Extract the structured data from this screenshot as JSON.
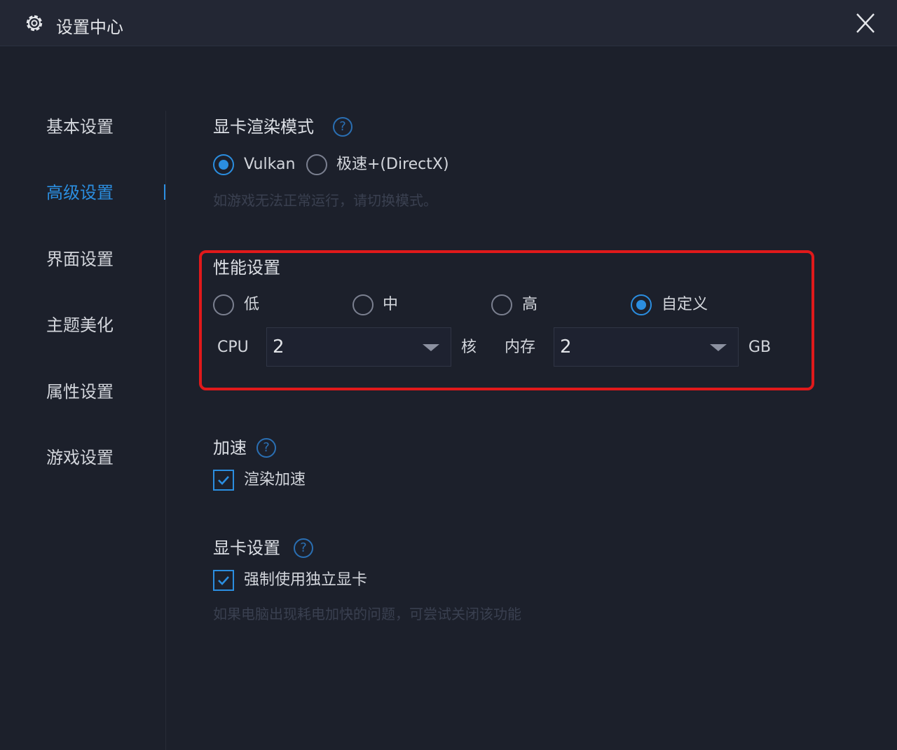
{
  "window": {
    "title": "设置中心",
    "title_icon": "gear-icon",
    "close_icon": "close-icon"
  },
  "sidebar": {
    "items": [
      {
        "label": "基本设置",
        "active": false
      },
      {
        "label": "高级设置",
        "active": true
      },
      {
        "label": "界面设置",
        "active": false
      },
      {
        "label": "主题美化",
        "active": false
      },
      {
        "label": "属性设置",
        "active": false
      },
      {
        "label": "游戏设置",
        "active": false
      }
    ]
  },
  "render_mode": {
    "title": "显卡渲染模式",
    "help": "?",
    "options": [
      {
        "label": "Vulkan",
        "checked": true
      },
      {
        "label": "极速+(DirectX)",
        "checked": false
      }
    ],
    "hint": "如游戏无法正常运行，请切换模式。"
  },
  "performance": {
    "title": "性能设置",
    "options": [
      {
        "label": "低",
        "checked": false
      },
      {
        "label": "中",
        "checked": false
      },
      {
        "label": "高",
        "checked": false
      },
      {
        "label": "自定义",
        "checked": true
      }
    ],
    "cpu_label": "CPU",
    "cpu_value": "2",
    "cpu_unit": "核",
    "memory_label": "内存",
    "memory_value": "2",
    "memory_unit": "GB"
  },
  "acceleration": {
    "title": "加速",
    "help": "?",
    "option": {
      "label": "渲染加速",
      "checked": true
    }
  },
  "gpu": {
    "title": "显卡设置",
    "help": "?",
    "option": {
      "label": "强制使用独立显卡",
      "checked": true
    },
    "hint": "如果电脑出现耗电加快的问题，可尝试关闭该功能"
  },
  "colors": {
    "accent": "#2b8ee0",
    "highlight": "#e0191b",
    "background": "#1c202b"
  }
}
